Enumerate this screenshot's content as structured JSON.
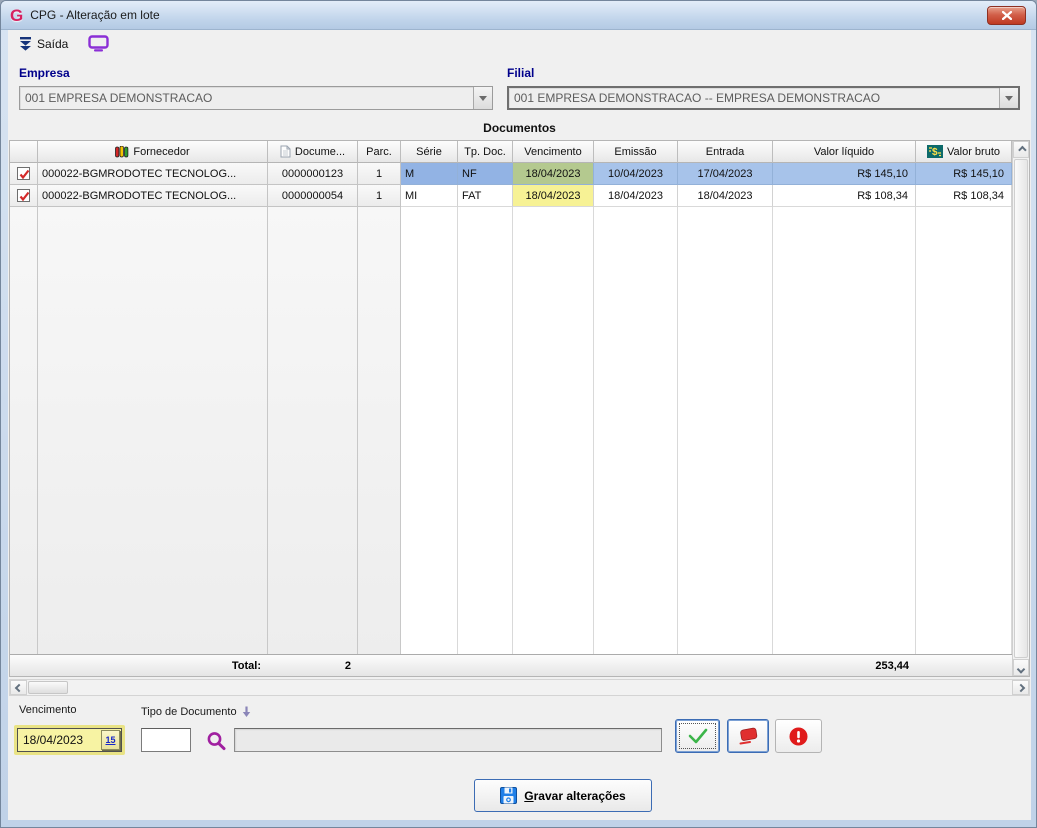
{
  "window": {
    "title": "CPG - Alteração em lote"
  },
  "toolbar": {
    "saida_label": "Saída"
  },
  "filters": {
    "empresa": {
      "label": "Empresa",
      "value": "001 EMPRESA DEMONSTRACAO"
    },
    "filial": {
      "label": "Filial",
      "value": "001 EMPRESA DEMONSTRACAO -- EMPRESA DEMONSTRACAO"
    }
  },
  "documentos": {
    "caption": "Documentos",
    "columns": {
      "fornecedor": "Fornecedor",
      "documento": "Docume...",
      "parcela": "Parc.",
      "serie": "Série",
      "tp_doc": "Tp. Doc.",
      "vencimento": "Vencimento",
      "emissao": "Emissão",
      "entrada": "Entrada",
      "valor_liquido": "Valor líquido",
      "valor_bruto": "Valor bruto"
    },
    "rows": [
      {
        "checked": true,
        "selected": true,
        "fornecedor": "000022-BGMRODOTEC TECNOLOG...",
        "documento": "0000000123",
        "parcela": "1",
        "serie": "M",
        "tp_doc": "NF",
        "vencimento": "18/04/2023",
        "emissao": "10/04/2023",
        "entrada": "17/04/2023",
        "valor_liquido": "R$ 145,10",
        "valor_bruto": "R$ 145,10"
      },
      {
        "checked": true,
        "selected": false,
        "fornecedor": "000022-BGMRODOTEC TECNOLOG...",
        "documento": "0000000054",
        "parcela": "1",
        "serie": "MI",
        "tp_doc": "FAT",
        "vencimento": "18/04/2023",
        "emissao": "18/04/2023",
        "entrada": "18/04/2023",
        "valor_liquido": "R$ 108,34",
        "valor_bruto": "R$ 108,34"
      }
    ],
    "footer": {
      "total_label": "Total:",
      "count": "2",
      "valor_total": "253,44"
    }
  },
  "edit_panel": {
    "vencimento": {
      "label": "Vencimento",
      "value": "18/04/2023",
      "calendar_day": "15"
    },
    "tipo_documento": {
      "label": "Tipo de Documento",
      "code_value": "",
      "description_value": ""
    },
    "gravar_button": {
      "accel": "G",
      "rest": "ravar alterações"
    }
  },
  "icons": {
    "close": "x",
    "exit": "double-chevron-down",
    "monitor": "purple-screen",
    "fornecedor": "people-bars",
    "documento": "sheet",
    "valor_bruto": "money-teal",
    "calendar": "day-15",
    "search": "magnifier",
    "confirm": "green-check",
    "clear": "red-eraser",
    "alert": "red-exclamation",
    "save": "blue-floppy"
  },
  "colors": {
    "selection_blue": "#a7c3ea",
    "highlight_yellow": "#f7f295",
    "highlight_green": "#b4c98f",
    "label_navy": "#00008b",
    "close_red": "#bf3a22",
    "search_purple": "#a020a0"
  }
}
